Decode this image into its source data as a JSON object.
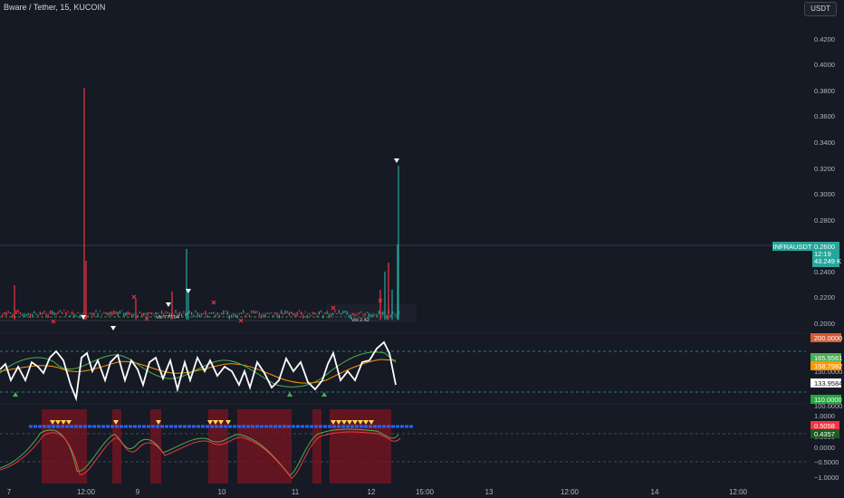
{
  "header": {
    "symbol_title": "Bware / Tether, 15, KUCOIN",
    "currency": "USDT"
  },
  "price_axis": {
    "ticks": [
      "0.4200",
      "0.4000",
      "0.3800",
      "0.3600",
      "0.3400",
      "0.3200",
      "0.3000",
      "0.2800",
      "0.2400",
      "0.2200",
      "0.2000"
    ]
  },
  "price_badges": {
    "symbol_label": "INFRAUSDT",
    "last_price": "0.2600",
    "countdown": "12:19",
    "volume": "43.249 K"
  },
  "volume_labels": {
    "left": "Vol 777.94",
    "right": "Vol 2.42"
  },
  "osc1_axis": {
    "ticks": [
      "150.0000",
      "100.0000"
    ]
  },
  "osc1_badges": [
    {
      "value": "200.0000",
      "bg": "#d65a31",
      "fg": "#ffffff"
    },
    {
      "value": "165.5561",
      "bg": "#4caf50",
      "fg": "#ffffff"
    },
    {
      "value": "158.7982",
      "bg": "#ff9800",
      "fg": "#ffffff"
    },
    {
      "value": "133.9584",
      "bg": "#ffffff",
      "fg": "#131722"
    },
    {
      "value": "110.0000",
      "bg": "#26a641",
      "fg": "#ffffff"
    }
  ],
  "osc2_axis": {
    "ticks": [
      "1.0000",
      "0.5000",
      "0.0000",
      "−0.5000",
      "−1.0000"
    ]
  },
  "osc2_badges": [
    {
      "value": "0.5058",
      "bg": "#f23645",
      "fg": "#ffffff"
    },
    {
      "value": "0.4357",
      "bg": "#1b5e20",
      "fg": "#ffffff"
    }
  ],
  "time_axis": {
    "ticks": [
      "7",
      "12:00",
      "9",
      "10",
      "11",
      "12",
      "15:00",
      "13",
      "12:00",
      "14",
      "12:00"
    ]
  },
  "colors": {
    "background": "#161a25",
    "up": "#26a69a",
    "down": "#f23645",
    "grid": "#1e222d"
  },
  "icons": [
    "down-triangle-marker-icon",
    "up-triangle-marker-icon",
    "cross-marker-icon"
  ]
}
